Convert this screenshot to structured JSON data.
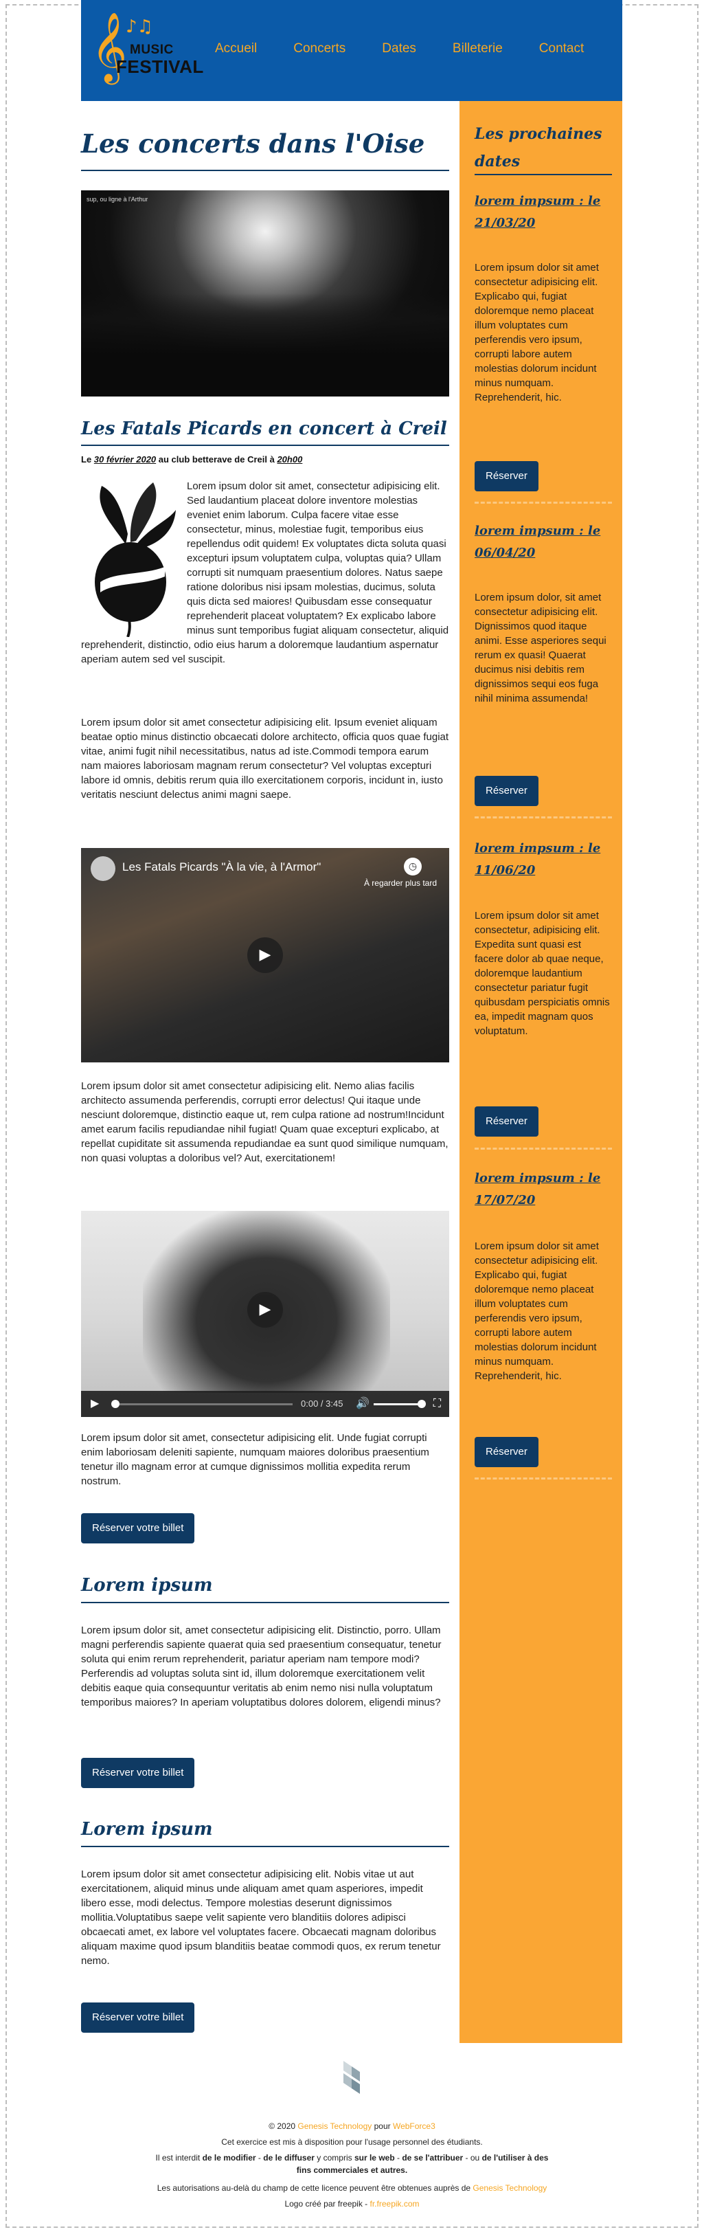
{
  "header": {
    "logo_top": "MUSIC",
    "logo_bottom": "FESTIVAL",
    "nav": [
      "Accueil",
      "Concerts",
      "Dates",
      "Billeterie",
      "Contact"
    ]
  },
  "main": {
    "title": "Les concerts dans l'Oise",
    "image_caption": "sup, ou ligne à l'Arthur",
    "article1": {
      "title": "Les Fatals Picards en concert à Creil",
      "meta_prefix": "Le ",
      "meta_date": "30 février 2020",
      "meta_middle": " au club betterave de Creil à ",
      "meta_time": "20h00",
      "p1": "Lorem ipsum dolor sit amet, consectetur adipisicing elit. Sed laudantium placeat dolore inventore molestias eveniet enim laborum. Culpa facere vitae esse consectetur, minus, molestiae fugit, temporibus eius repellendus odit quidem! Ex voluptates dicta soluta quasi excepturi ipsum voluptatem culpa, voluptas quia? Ullam corrupti sit numquam praesentium dolores. Natus saepe ratione doloribus nisi ipsam molestias, ducimus, soluta quis dicta sed maiores! Quibusdam esse consequatur reprehenderit placeat voluptatem? Ex explicabo labore minus sunt temporibus fugiat aliquam consectetur, aliquid reprehenderit, distinctio, odio eius harum a doloremque laudantium aspernatur aperiam autem sed vel suscipit.",
      "p2": "Lorem ipsum dolor sit amet consectetur adipisicing elit. Ipsum eveniet aliquam beatae optio minus distinctio obcaecati dolore architecto, officia quos quae fugiat vitae, animi fugit nihil necessitatibus, natus ad iste.Commodi tempora earum nam maiores laboriosam magnam rerum consectetur? Vel voluptas excepturi labore id omnis, debitis rerum quia illo exercitationem corporis, incidunt in, iusto veritatis nesciunt delectus animi magni saepe.",
      "video1_title": "Les Fatals Picards \"À la vie, à l'Armor\"",
      "video1_later": "À regarder plus tard",
      "p3": "Lorem ipsum dolor sit amet consectetur adipisicing elit. Nemo alias facilis architecto assumenda perferendis, corrupti error delectus! Qui itaque unde nesciunt doloremque, distinctio eaque ut, rem culpa ratione ad nostrum!Incidunt amet earum facilis repudiandae nihil fugiat! Quam quae excepturi explicabo, at repellat cupiditate sit assumenda repudiandae ea sunt quod similique numquam, non quasi voluptas a doloribus vel? Aut, exercitationem!",
      "video2_time": "0:00 / 3:45",
      "p4": "Lorem ipsum dolor sit amet, consectetur adipisicing elit. Unde fugiat corrupti enim laboriosam deleniti sapiente, numquam maiores doloribus praesentium tenetur illo magnam error at cumque dignissimos mollitia expedita rerum nostrum.",
      "button": "Réserver votre billet"
    },
    "article2": {
      "title": "Lorem ipsum",
      "text": "Lorem ipsum dolor sit, amet consectetur adipisicing elit. Distinctio, porro. Ullam magni perferendis sapiente quaerat quia sed praesentium consequatur, tenetur soluta qui enim rerum reprehenderit, pariatur aperiam nam tempore modi?Perferendis ad voluptas soluta sint id, illum doloremque exercitationem velit debitis eaque quia consequuntur veritatis ab enim nemo nisi nulla voluptatum temporibus maiores? In aperiam voluptatibus dolores dolorem, eligendi minus?",
      "button": "Réserver votre billet"
    },
    "article3": {
      "title": "Lorem ipsum",
      "text": "Lorem ipsum dolor sit amet consectetur adipisicing elit. Nobis vitae ut aut exercitationem, aliquid minus unde aliquam amet quam asperiores, impedit libero esse, modi delectus. Tempore molestias deserunt dignissimos mollitia.Voluptatibus saepe velit sapiente vero blanditiis dolores adipisci obcaecati amet, ex labore vel voluptates facere. Obcaecati magnam doloribus aliquam maxime quod ipsum blanditiis beatae commodi quos, ex rerum tenetur nemo.",
      "button": "Réserver votre billet"
    }
  },
  "sidebar": {
    "title": "Les prochaines dates",
    "events": [
      {
        "title": "lorem impsum : le 21/03/20",
        "text": "Lorem ipsum dolor sit amet consectetur adipisicing elit. Explicabo qui, fugiat doloremque nemo placeat illum voluptates cum perferendis vero ipsum, corrupti labore autem molestias dolorum incidunt minus numquam. Reprehenderit, hic.",
        "button": "Réserver"
      },
      {
        "title": "lorem impsum : le 06/04/20",
        "text": "Lorem ipsum dolor, sit amet consectetur adipisicing elit. Dignissimos quod itaque animi. Esse asperiores sequi rerum ex quasi! Quaerat ducimus nisi debitis rem dignissimos sequi eos fuga nihil minima assumenda!",
        "button": "Réserver"
      },
      {
        "title": "lorem impsum : le 11/06/20",
        "text": "Lorem ipsum dolor sit amet consectetur, adipisicing elit. Expedita sunt quasi est facere dolor ab quae neque, doloremque laudantium consectetur pariatur fugit quibusdam perspiciatis omnis ea, impedit magnam quos voluptatum.",
        "button": "Réserver"
      },
      {
        "title": "lorem impsum : le 17/07/20",
        "text": "Lorem ipsum dolor sit amet consectetur adipisicing elit. Explicabo qui, fugiat doloremque nemo placeat illum voluptates cum perferendis vero ipsum, corrupti labore autem molestias dolorum incidunt minus numquam. Reprehenderit, hic.",
        "button": "Réserver"
      }
    ]
  },
  "footer": {
    "copy_prefix": "© 2020 ",
    "company": "Genesis Technology",
    "copy_mid": " pour ",
    "client": "WebForce3",
    "line2": "Cet exercice est mis à disposition pour l'usage personnel des étudiants.",
    "line3_a": "Il est interdit ",
    "line3_b": "de le modifier",
    "line3_c": " - ",
    "line3_d": "de le diffuser",
    "line3_e": " y compris ",
    "line3_f": "sur le web",
    "line3_g": " - ",
    "line3_h": "de se l'attribuer",
    "line3_i": " - ou ",
    "line3_j": "de l'utiliser à des fins commerciales et autres.",
    "line4_prefix": "Les autorisations au-delà du champ de cette licence peuvent être obtenues auprès de ",
    "line4_company": "Genesis Technology",
    "line5_prefix": "Logo créé par freepik - ",
    "line5_link": "fr.freepik.com"
  },
  "colors": {
    "header_bg": "#0b5aa8",
    "accent": "#f5a623",
    "sidebar_bg": "#faa634",
    "title_blue": "#0f3a63",
    "button_bg": "#0f3a63"
  }
}
